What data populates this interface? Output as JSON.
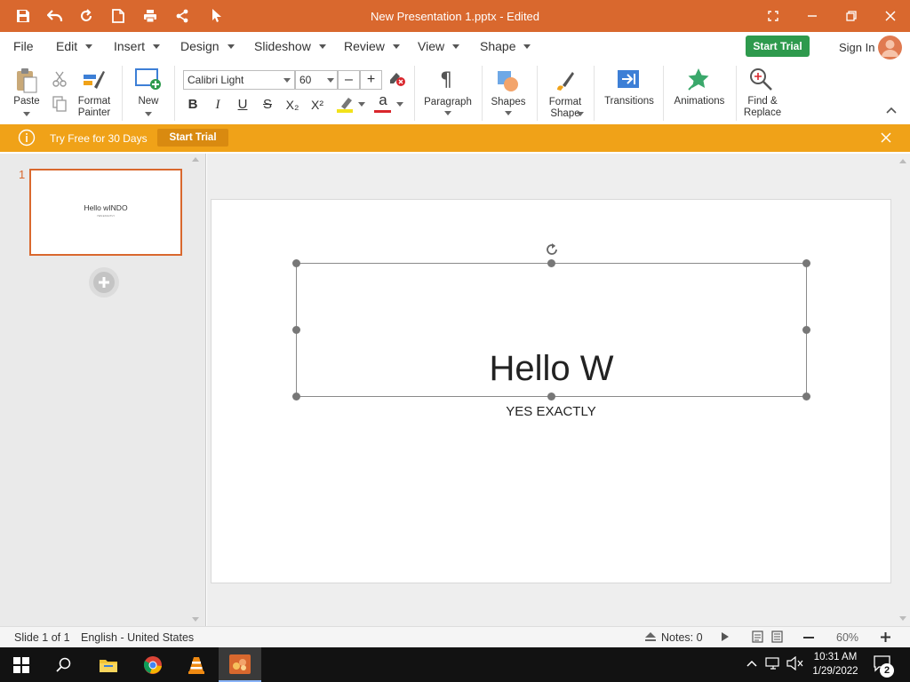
{
  "window": {
    "title": "New Presentation 1.pptx - Edited"
  },
  "menu": [
    "File",
    "Edit",
    "Insert",
    "Design",
    "Slideshow",
    "Review",
    "View",
    "Shape"
  ],
  "header": {
    "trial_button": "Start Trial",
    "sign_in": "Sign In"
  },
  "ribbon": {
    "paste": "Paste",
    "format_painter_1": "Format",
    "format_painter_2": "Painter",
    "new": "New",
    "font_name": "Calibri Light",
    "font_size": "60",
    "paragraph": "Paragraph",
    "shapes": "Shapes",
    "format_shape_1": "Format",
    "format_shape_2": "Shape",
    "transitions": "Transitions",
    "animations": "Animations",
    "find_1": "Find &",
    "find_2": "Replace",
    "bold": "B",
    "italic": "I",
    "underline": "U",
    "strike": "S",
    "sub": "X₂",
    "sup": "X²",
    "font_color": "a"
  },
  "infobar": {
    "text": "Try Free for 30 Days",
    "button": "Start Trial"
  },
  "thumbs": [
    {
      "number": "1",
      "title": "Hello wINDO",
      "subtitle": "YES EXACTLY"
    }
  ],
  "slide": {
    "title": "Hello W",
    "subtitle": "YES EXACTLY"
  },
  "status": {
    "slide": "Slide 1 of 1",
    "language": "English - United States",
    "notes": "Notes: 0",
    "zoom": "60%"
  },
  "taskbar": {
    "time": "10:31 AM",
    "date": "1/29/2022",
    "notifications": "2"
  },
  "colors": {
    "title_bar": "#d9682e",
    "info_bar": "#f0a218",
    "trial_button": "#2e9a4d",
    "thumb_border": "#d9682e",
    "highlight": "#f2e21b",
    "font_color": "#d9262c"
  }
}
